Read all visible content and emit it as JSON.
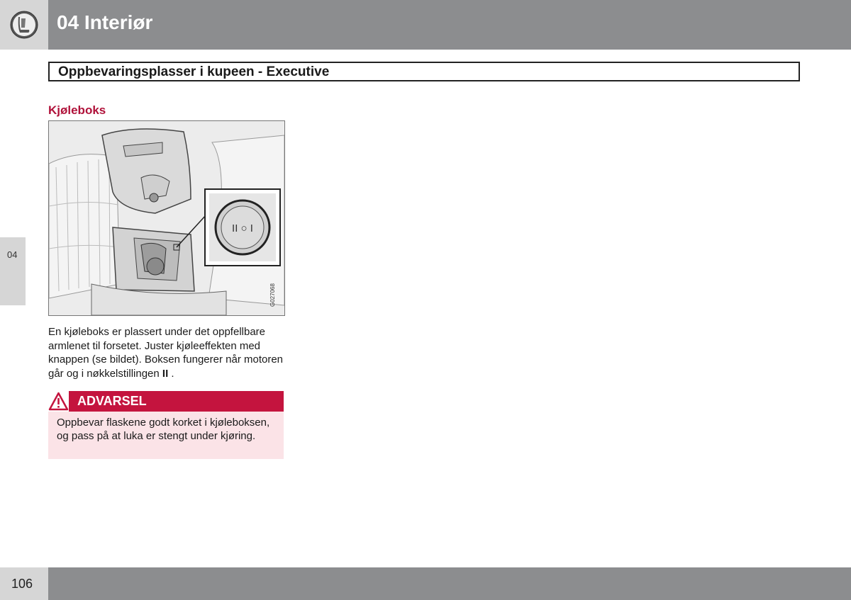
{
  "header": {
    "chapter_title": "04 Interiør",
    "icon": "seat-icon"
  },
  "section": {
    "title": "Oppbevaringsplasser i kupeen - Executive"
  },
  "side_tab": {
    "label": "04"
  },
  "subsection": {
    "heading": "Kjøleboks"
  },
  "figure": {
    "image_code": "G027068",
    "button_symbols": "II ○ I"
  },
  "body": {
    "text": "En kjøleboks er plassert under det oppfellbare armlenet til forsetet. Juster kjøleeffekten med knappen (se bildet). Boksen fungerer når motoren går og i nøkkelstillingen",
    "key_position": "II",
    "end_punct": " ."
  },
  "warning": {
    "title": "ADVARSEL",
    "icon": "warning-triangle-icon",
    "text": "Oppbevar flaskene godt korket i kjøleboksen, og pass på at luka er stengt under kjøring."
  },
  "footer": {
    "page_number": "106"
  },
  "colors": {
    "header_gray": "#8c8d8f",
    "light_gray": "#d6d6d6",
    "accent_red": "#c4143e",
    "warning_bg": "#fbe3e7"
  }
}
